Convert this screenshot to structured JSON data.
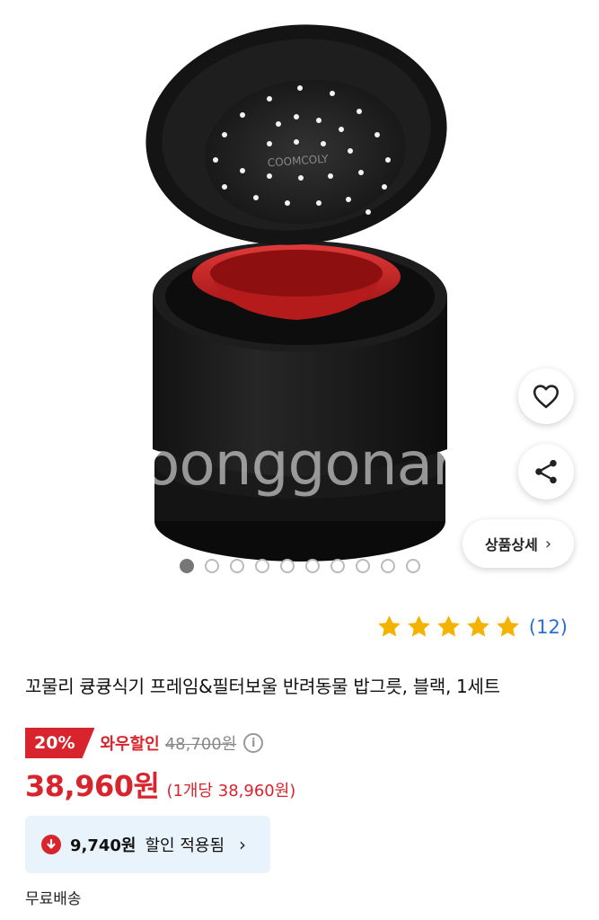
{
  "product_image": {
    "watermark": "oonggonara",
    "brand_text": "COOMCOLY",
    "carousel": {
      "total": 10,
      "active_index": 0
    }
  },
  "actions": {
    "wishlist_icon": "heart-icon",
    "share_icon": "share-icon",
    "detail_label": "상품상세",
    "detail_chevron": "›"
  },
  "rating": {
    "stars": 5,
    "count_label": "(12)",
    "star_color": "#f5b301"
  },
  "product": {
    "title": "꼬물리 큥큥식기 프레임&필터보울 반려동물 밥그릇, 블랙, 1세트"
  },
  "pricing": {
    "discount_badge": "20%",
    "discount_label": "와우할인",
    "original_price": "48,700원",
    "price": "38,960원",
    "unit_price": "(1개당 38,960원)",
    "accent_color": "#d8242d"
  },
  "coupon": {
    "amount": "9,740원",
    "text": "할인 적용됨",
    "chevron": "›"
  },
  "shipping": {
    "label": "무료배송"
  }
}
